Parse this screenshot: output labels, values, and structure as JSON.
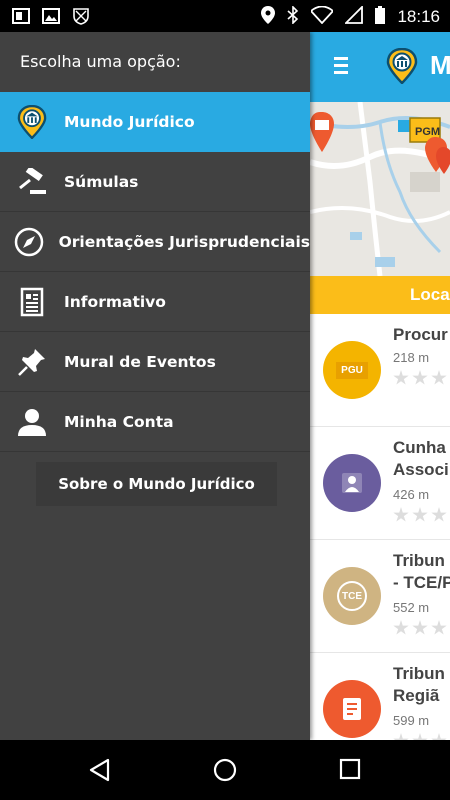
{
  "status_bar": {
    "time": "18:16",
    "left_icons": [
      "tablet-icon",
      "image-icon",
      "shield-icon"
    ],
    "right_icons": [
      "location-icon",
      "bluetooth-icon",
      "wifi-icon",
      "signal-icon",
      "battery-icon"
    ]
  },
  "drawer": {
    "header": "Escolha uma opção:",
    "items": [
      {
        "label": "Mundo Jurídico",
        "icon": "logo-icon",
        "active": true
      },
      {
        "label": "Súmulas",
        "icon": "gavel-icon"
      },
      {
        "label": "Orientações Jurisprudenciais",
        "icon": "compass-icon"
      },
      {
        "label": "Informativo",
        "icon": "newspaper-icon"
      },
      {
        "label": "Mural de Eventos",
        "icon": "pushpin-icon"
      },
      {
        "label": "Minha Conta",
        "icon": "user-icon"
      }
    ],
    "about_button": "Sobre o Mundo Jurídico"
  },
  "app": {
    "title": "M",
    "map_marker_label": "PGM",
    "tab_label": "Loca",
    "places": [
      {
        "name_lines": [
          "Procur"
        ],
        "distance": "218 m",
        "badge_text": "PGU",
        "badge_color": "#f4b400"
      },
      {
        "name_lines": [
          "Cunha",
          "Associ"
        ],
        "distance": "426 m",
        "badge_text": "",
        "badge_color": "#6a5d9e"
      },
      {
        "name_lines": [
          "Tribun",
          "- TCE/P"
        ],
        "distance": "552 m",
        "badge_text": "TCE",
        "badge_color": "#cfb482"
      },
      {
        "name_lines": [
          "Tribun",
          "Regiã"
        ],
        "distance": "599 m",
        "badge_text": "",
        "badge_color": "#ee5a2f"
      }
    ]
  },
  "nav_bar": {
    "buttons": [
      "back-icon",
      "home-icon",
      "recents-icon"
    ]
  },
  "colors": {
    "accent_blue": "#29aae2",
    "drawer_bg": "#414141",
    "tab_yellow": "#fbbd19"
  }
}
